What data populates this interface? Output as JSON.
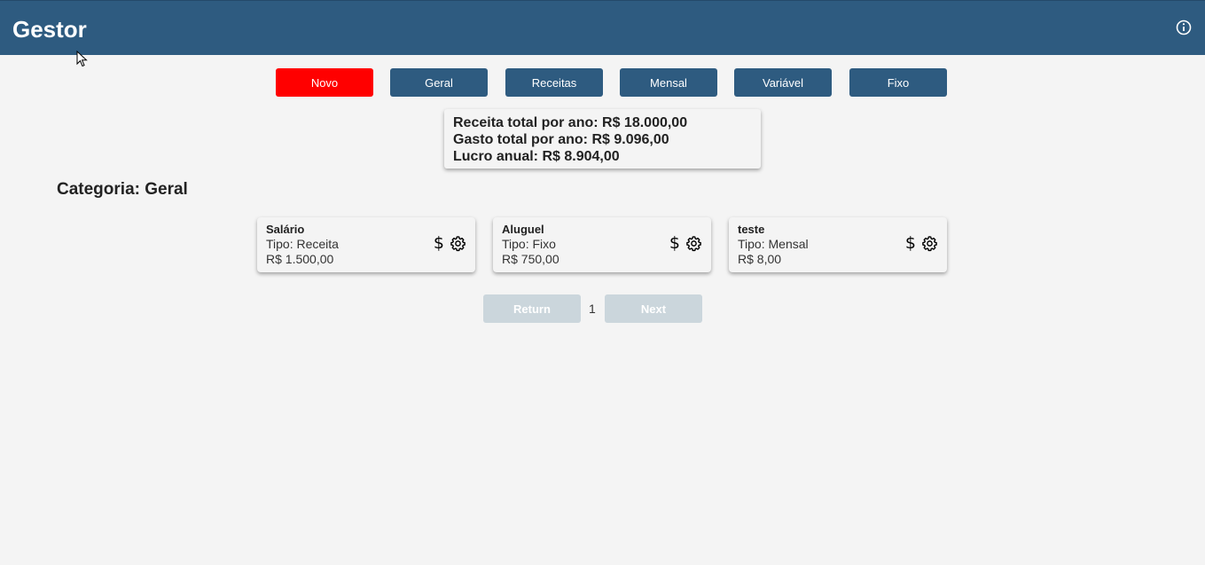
{
  "header": {
    "title": "Gestor",
    "info_icon": "info-icon"
  },
  "nav": {
    "buttons": [
      {
        "label": "Novo",
        "active": true
      },
      {
        "label": "Geral"
      },
      {
        "label": "Receitas"
      },
      {
        "label": "Mensal"
      },
      {
        "label": "Variável"
      },
      {
        "label": "Fixo"
      }
    ]
  },
  "summary": {
    "receita": "Receita total por ano: R$ 18.000,00",
    "gasto": "Gasto total por ano: R$ 9.096,00",
    "lucro": "Lucro anual: R$ 8.904,00"
  },
  "category": {
    "title": "Categoria: Geral"
  },
  "cards": [
    {
      "name": "Salário",
      "type": "Tipo: Receita",
      "value": "R$ 1.500,00"
    },
    {
      "name": "Aluguel",
      "type": "Tipo: Fixo",
      "value": "R$ 750,00"
    },
    {
      "name": "teste",
      "type": "Tipo: Mensal",
      "value": "R$ 8,00"
    }
  ],
  "card_icons": {
    "dollar": "$",
    "dollar_icon": "dollar-icon",
    "settings_icon": "gear-icon"
  },
  "pagination": {
    "return_label": "Return",
    "page": "1",
    "next_label": "Next"
  },
  "colors": {
    "header": "#2e5b80",
    "active": "#ff0000",
    "disabled": "#cbd6dc",
    "background": "#f4f4f4"
  }
}
